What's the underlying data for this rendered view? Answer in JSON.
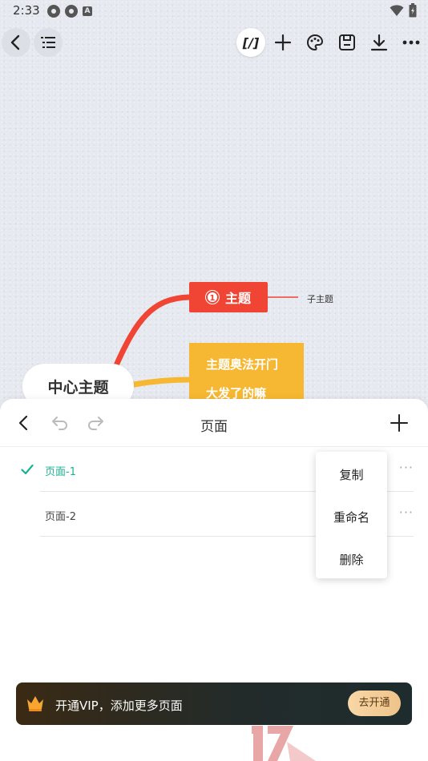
{
  "status_bar": {
    "time": "2:33",
    "letter_icon": "A"
  },
  "toolbar": {
    "icons": [
      "back-arrow-icon",
      "outline-list-icon",
      "formula-icon",
      "add-icon",
      "palette-icon",
      "save-icon",
      "download-icon",
      "more-icon"
    ],
    "formula_label": "[/]"
  },
  "mindmap": {
    "center": "中心主题",
    "topic": "主题",
    "topic_badge": "1",
    "subtopic": "子主题",
    "yellow_line1": "主题奥法开门",
    "yellow_line2": "大发了的嘛"
  },
  "sheet": {
    "title": "页面",
    "pages": [
      {
        "label": "页面-1",
        "selected": true
      },
      {
        "label": "页面-2",
        "selected": false
      }
    ],
    "more": "···"
  },
  "context_menu": {
    "copy": "复制",
    "rename": "重命名",
    "delete": "删除"
  },
  "vip": {
    "text": "开通VIP，添加更多页面",
    "button": "去开通"
  },
  "colors": {
    "accent": "#1ab394",
    "topic": "#f04434",
    "topic_yellow": "#f6b832"
  }
}
